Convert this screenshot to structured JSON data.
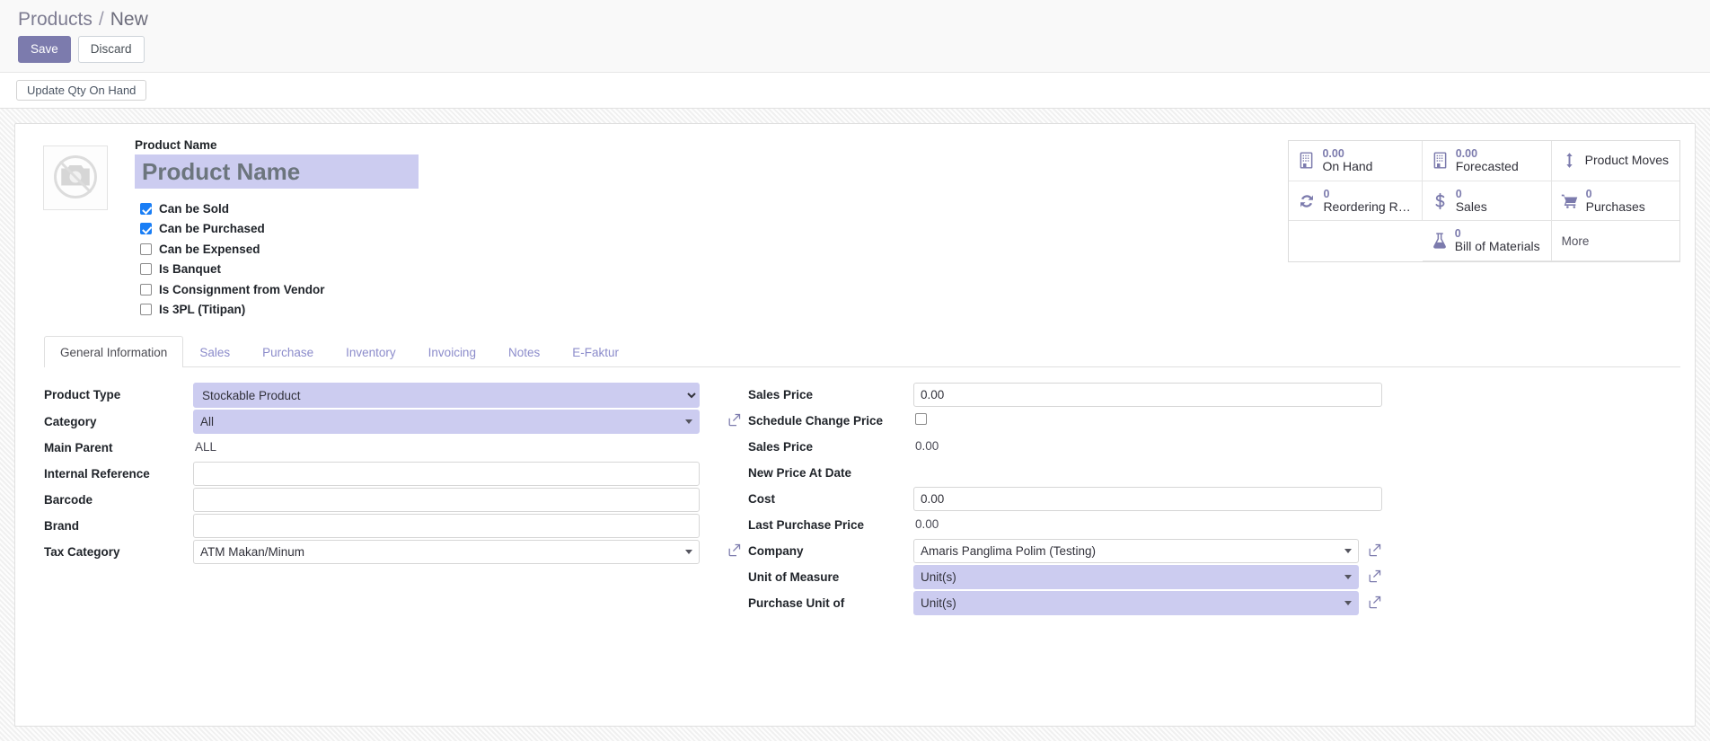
{
  "breadcrumb": {
    "parent": "Products",
    "separator": "/",
    "current": "New"
  },
  "toolbar": {
    "save_label": "Save",
    "discard_label": "Discard"
  },
  "actionbar": {
    "update_qty_label": "Update Qty On Hand"
  },
  "product": {
    "name_label": "Product Name",
    "name_value": "",
    "name_placeholder": "Product Name"
  },
  "checkboxes": [
    {
      "label": "Can be Sold",
      "checked": true
    },
    {
      "label": "Can be Purchased",
      "checked": true
    },
    {
      "label": "Can be Expensed",
      "checked": false
    },
    {
      "label": "Is Banquet",
      "checked": false
    },
    {
      "label": "Is Consignment from Vendor",
      "checked": false
    },
    {
      "label": "Is 3PL (Titipan)",
      "checked": false
    }
  ],
  "stat_buttons": [
    {
      "value": "0.00",
      "label": "On Hand",
      "icon": "building-icon"
    },
    {
      "value": "0.00",
      "label": "Forecasted",
      "icon": "building-icon"
    },
    {
      "value": "",
      "label": "Product Moves",
      "icon": "arrows-v-icon"
    },
    {
      "value": "0",
      "label": "Reordering R…",
      "icon": "refresh-icon"
    },
    {
      "value": "0",
      "label": "Sales",
      "icon": "dollar-icon"
    },
    {
      "value": "0",
      "label": "Purchases",
      "icon": "cart-icon"
    },
    {
      "value": "0",
      "label": "Bill of Materials",
      "icon": "flask-icon"
    },
    {
      "value": "",
      "label": "More",
      "icon": ""
    }
  ],
  "tabs": [
    {
      "label": "General Information",
      "active": true
    },
    {
      "label": "Sales",
      "active": false
    },
    {
      "label": "Purchase",
      "active": false
    },
    {
      "label": "Inventory",
      "active": false
    },
    {
      "label": "Invoicing",
      "active": false
    },
    {
      "label": "Notes",
      "active": false
    },
    {
      "label": "E-Faktur",
      "active": false
    }
  ],
  "left_fields": {
    "product_type": {
      "label": "Product Type",
      "value": "Stockable Product"
    },
    "category": {
      "label": "Category",
      "value": "All"
    },
    "main_parent": {
      "label": "Main Parent",
      "value": "ALL"
    },
    "internal_reference": {
      "label": "Internal Reference",
      "value": ""
    },
    "barcode": {
      "label": "Barcode",
      "value": ""
    },
    "brand": {
      "label": "Brand",
      "value": ""
    },
    "tax_category": {
      "label": "Tax Category",
      "value": "ATM Makan/Minum"
    }
  },
  "right_fields": {
    "sales_price": {
      "label": "Sales Price",
      "value": "0.00"
    },
    "schedule_change_price": {
      "label": "Schedule Change Price",
      "checked": false
    },
    "sales_price_ro": {
      "label": "Sales Price",
      "value": "0.00"
    },
    "new_price_at_date": {
      "label": "New Price At Date",
      "value": ""
    },
    "cost": {
      "label": "Cost",
      "value": "0.00"
    },
    "last_purchase_price": {
      "label": "Last Purchase Price",
      "value": "0.00"
    },
    "company": {
      "label": "Company",
      "value": "Amaris Panglima Polim (Testing)"
    },
    "unit_of_measure": {
      "label": "Unit of Measure",
      "value": "Unit(s)"
    },
    "purchase_unit_of": {
      "label": "Purchase Unit of",
      "value": "Unit(s)"
    }
  },
  "colors": {
    "brand_purple": "#7c7bad",
    "field_highlight": "#ccccf0",
    "checkbox_blue": "#1a7ef5"
  }
}
